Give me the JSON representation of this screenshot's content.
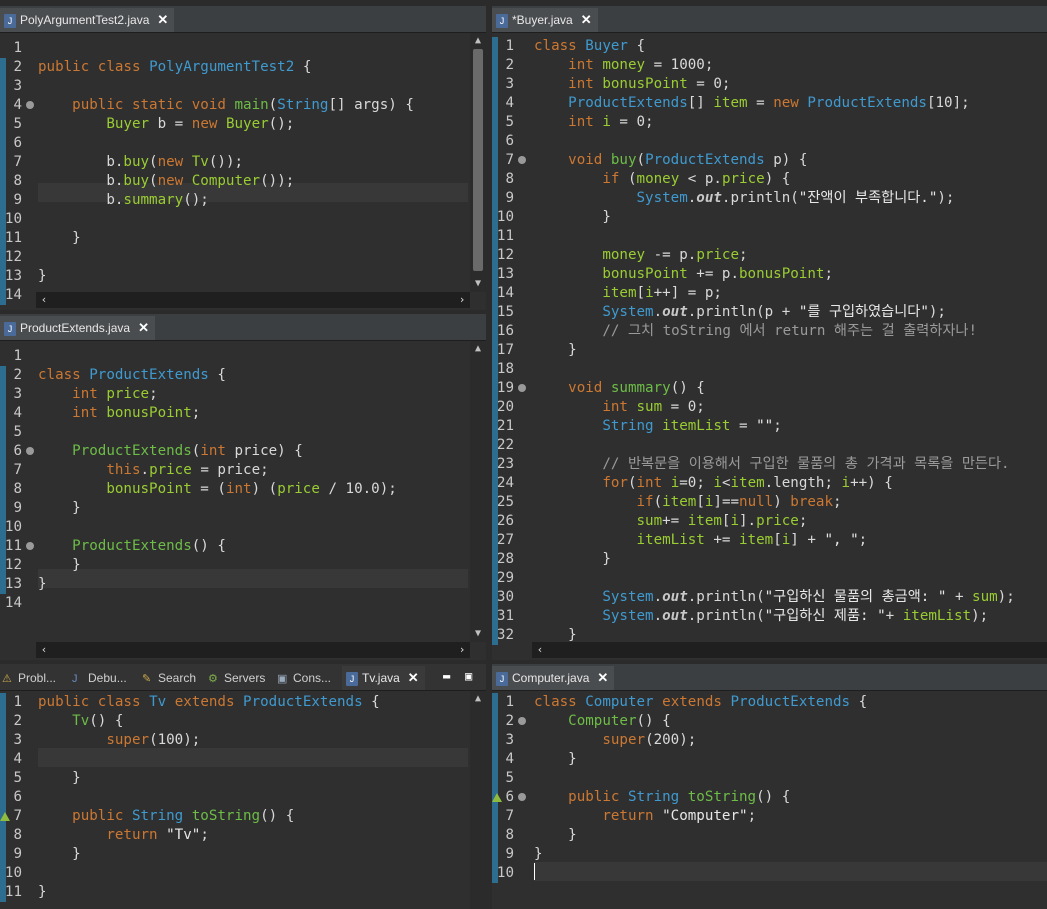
{
  "panes": {
    "poly": {
      "tab": "PolyArgumentTest2.java",
      "lines": [
        "",
        "<span class='kw'>public</span> <span class='kw'>class</span> <span class='ty'>PolyArgumentTest2</span> {",
        "",
        "    <span class='kw'>public</span> <span class='kw'>static</span> <span class='kw'>void</span> <span class='fn'>main</span>(<span class='ty'>String</span>[] args) {",
        "        <span class='mname'>Buyer</span> b = <span class='kw'>new</span> <span class='mname'>Buyer</span>();",
        "",
        "        b.<span class='mname'>buy</span>(<span class='kw'>new</span> <span class='mname'>Tv</span>());",
        "        b.<span class='mname'>buy</span>(<span class='kw'>new</span> <span class='mname'>Computer</span>());",
        "        b.<span class='mname'>summary</span>();",
        "",
        "    }",
        "",
        "}",
        ""
      ]
    },
    "product": {
      "tab": "ProductExtends.java",
      "lines": [
        "",
        "<span class='kw'>class</span> <span class='ty'>ProductExtends</span> {",
        "    <span class='kw'>int</span> <span class='mname'>price</span>;",
        "    <span class='kw'>int</span> <span class='mname'>bonusPoint</span>;",
        "",
        "    <span class='fn'>ProductExtends</span>(<span class='kw'>int</span> price) {",
        "        <span class='kw'>this</span>.<span class='mname'>price</span> = price;",
        "        <span class='mname'>bonusPoint</span> = (<span class='kw'>int</span>) (<span class='mname'>price</span> / 10.0);",
        "    }",
        "",
        "    <span class='fn'>ProductExtends</span>() {",
        "    }",
        "}",
        ""
      ]
    },
    "buyer": {
      "tab": "*Buyer.java",
      "lines": [
        "<span class='kw'>class</span> <span class='ty'>Buyer</span> {",
        "    <span class='kw'>int</span> <span class='mname'>money</span> = 1000;",
        "    <span class='kw'>int</span> <span class='mname'>bonusPoint</span> = 0;",
        "    <span class='ty'>ProductExtends</span>[] <span class='mname'>item</span> = <span class='kw'>new</span> <span class='ty'>ProductExtends</span>[10];",
        "    <span class='kw'>int</span> <span class='mname'>i</span> = 0;",
        "",
        "    <span class='kw'>void</span> <span class='fn'>buy</span>(<span class='ty'>ProductExtends</span> p) {",
        "        <span class='kw'>if</span> (<span class='mname'>money</span> &lt; p.<span class='mname'>price</span>) {",
        "            <span class='ty'>System</span>.<span class='it'>out</span>.println(<span class='str'>\"잔액이 부족합니다.\"</span>);",
        "        }",
        "",
        "        <span class='mname'>money</span> -= p.<span class='mname'>price</span>;",
        "        <span class='mname'>bonusPoint</span> += p.<span class='mname'>bonusPoint</span>;",
        "        <span class='mname'>item</span>[<span class='mname'>i</span>++] = p;",
        "        <span class='ty'>System</span>.<span class='it'>out</span>.println(p + <span class='str'>\"를 구입하였습니다\"</span>);",
        "        <span class='cm'>// 그치 toString 에서 return 해주는 걸 출력하자나!</span>",
        "    }",
        "",
        "    <span class='kw'>void</span> <span class='fn'>summary</span>() {",
        "        <span class='kw'>int</span> <span class='mname'>sum</span> = 0;",
        "        <span class='ty'>String</span> <span class='mname'>itemList</span> = <span class='str'>\"\"</span>;",
        "",
        "        <span class='cm'>// 반복문을 이용해서 구입한 물품의 총 가격과 목록을 만든다.</span>",
        "        <span class='kw'>for</span>(<span class='kw'>int</span> <span class='mname'>i</span>=0; <span class='mname'>i</span>&lt;<span class='mname'>item</span>.length; <span class='mname'>i</span>++) {",
        "            <span class='kw'>if</span>(<span class='mname'>item</span>[<span class='mname'>i</span>]==<span class='kw'>null</span>) <span class='kw'>break</span>;",
        "            <span class='mname'>sum</span>+= <span class='mname'>item</span>[<span class='mname'>i</span>].<span class='mname'>price</span>;",
        "            <span class='mname'>itemList</span> += <span class='mname'>item</span>[<span class='mname'>i</span>] + <span class='str'>\", \"</span>;",
        "        }",
        "",
        "        <span class='ty'>System</span>.<span class='it'>out</span>.println(<span class='str'>\"구입하신 물품의 총금액: \"</span> + <span class='mname'>sum</span>);",
        "        <span class='ty'>System</span>.<span class='it'>out</span>.println(<span class='str'>\"구입하신 제품: \"</span>+ <span class='mname'>itemList</span>);",
        "    }"
      ]
    },
    "tv": {
      "bottom_tabs": [
        "Probl...",
        "Debu...",
        "Search",
        "Servers",
        "Cons...",
        "Tv.java"
      ],
      "lines": [
        "<span class='kw'>public</span> <span class='kw'>class</span> <span class='ty'>Tv</span> <span class='kw'>extends</span> <span class='ty'>ProductExtends</span> {",
        "    <span class='fn'>Tv</span>() {",
        "        <span class='kw'>super</span>(100);",
        "",
        "    }",
        "",
        "    <span class='kw'>public</span> <span class='ty'>String</span> <span class='fn'>toString</span>() {",
        "        <span class='kw'>return</span> <span class='str'>\"Tv\"</span>;",
        "    }",
        "",
        "}"
      ]
    },
    "computer": {
      "tab": "Computer.java",
      "lines": [
        "<span class='kw'>class</span> <span class='ty'>Computer</span> <span class='kw'>extends</span> <span class='ty'>ProductExtends</span> {",
        "    <span class='fn'>Computer</span>() {",
        "        <span class='kw'>super</span>(200);",
        "    }",
        "",
        "    <span class='kw'>public</span> <span class='ty'>String</span> <span class='fn'>toString</span>() {",
        "        <span class='kw'>return</span> <span class='str'>\"Computer\"</span>;",
        "    }",
        "}",
        ""
      ]
    }
  }
}
